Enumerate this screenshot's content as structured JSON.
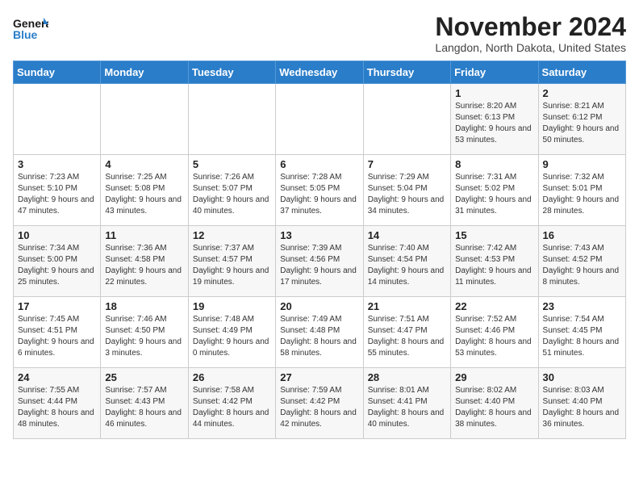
{
  "logo": {
    "line1": "General",
    "line2": "Blue"
  },
  "title": "November 2024",
  "location": "Langdon, North Dakota, United States",
  "weekdays": [
    "Sunday",
    "Monday",
    "Tuesday",
    "Wednesday",
    "Thursday",
    "Friday",
    "Saturday"
  ],
  "weeks": [
    [
      {
        "day": "",
        "info": ""
      },
      {
        "day": "",
        "info": ""
      },
      {
        "day": "",
        "info": ""
      },
      {
        "day": "",
        "info": ""
      },
      {
        "day": "",
        "info": ""
      },
      {
        "day": "1",
        "info": "Sunrise: 8:20 AM\nSunset: 6:13 PM\nDaylight: 9 hours and 53 minutes."
      },
      {
        "day": "2",
        "info": "Sunrise: 8:21 AM\nSunset: 6:12 PM\nDaylight: 9 hours and 50 minutes."
      }
    ],
    [
      {
        "day": "3",
        "info": "Sunrise: 7:23 AM\nSunset: 5:10 PM\nDaylight: 9 hours and 47 minutes."
      },
      {
        "day": "4",
        "info": "Sunrise: 7:25 AM\nSunset: 5:08 PM\nDaylight: 9 hours and 43 minutes."
      },
      {
        "day": "5",
        "info": "Sunrise: 7:26 AM\nSunset: 5:07 PM\nDaylight: 9 hours and 40 minutes."
      },
      {
        "day": "6",
        "info": "Sunrise: 7:28 AM\nSunset: 5:05 PM\nDaylight: 9 hours and 37 minutes."
      },
      {
        "day": "7",
        "info": "Sunrise: 7:29 AM\nSunset: 5:04 PM\nDaylight: 9 hours and 34 minutes."
      },
      {
        "day": "8",
        "info": "Sunrise: 7:31 AM\nSunset: 5:02 PM\nDaylight: 9 hours and 31 minutes."
      },
      {
        "day": "9",
        "info": "Sunrise: 7:32 AM\nSunset: 5:01 PM\nDaylight: 9 hours and 28 minutes."
      }
    ],
    [
      {
        "day": "10",
        "info": "Sunrise: 7:34 AM\nSunset: 5:00 PM\nDaylight: 9 hours and 25 minutes."
      },
      {
        "day": "11",
        "info": "Sunrise: 7:36 AM\nSunset: 4:58 PM\nDaylight: 9 hours and 22 minutes."
      },
      {
        "day": "12",
        "info": "Sunrise: 7:37 AM\nSunset: 4:57 PM\nDaylight: 9 hours and 19 minutes."
      },
      {
        "day": "13",
        "info": "Sunrise: 7:39 AM\nSunset: 4:56 PM\nDaylight: 9 hours and 17 minutes."
      },
      {
        "day": "14",
        "info": "Sunrise: 7:40 AM\nSunset: 4:54 PM\nDaylight: 9 hours and 14 minutes."
      },
      {
        "day": "15",
        "info": "Sunrise: 7:42 AM\nSunset: 4:53 PM\nDaylight: 9 hours and 11 minutes."
      },
      {
        "day": "16",
        "info": "Sunrise: 7:43 AM\nSunset: 4:52 PM\nDaylight: 9 hours and 8 minutes."
      }
    ],
    [
      {
        "day": "17",
        "info": "Sunrise: 7:45 AM\nSunset: 4:51 PM\nDaylight: 9 hours and 6 minutes."
      },
      {
        "day": "18",
        "info": "Sunrise: 7:46 AM\nSunset: 4:50 PM\nDaylight: 9 hours and 3 minutes."
      },
      {
        "day": "19",
        "info": "Sunrise: 7:48 AM\nSunset: 4:49 PM\nDaylight: 9 hours and 0 minutes."
      },
      {
        "day": "20",
        "info": "Sunrise: 7:49 AM\nSunset: 4:48 PM\nDaylight: 8 hours and 58 minutes."
      },
      {
        "day": "21",
        "info": "Sunrise: 7:51 AM\nSunset: 4:47 PM\nDaylight: 8 hours and 55 minutes."
      },
      {
        "day": "22",
        "info": "Sunrise: 7:52 AM\nSunset: 4:46 PM\nDaylight: 8 hours and 53 minutes."
      },
      {
        "day": "23",
        "info": "Sunrise: 7:54 AM\nSunset: 4:45 PM\nDaylight: 8 hours and 51 minutes."
      }
    ],
    [
      {
        "day": "24",
        "info": "Sunrise: 7:55 AM\nSunset: 4:44 PM\nDaylight: 8 hours and 48 minutes."
      },
      {
        "day": "25",
        "info": "Sunrise: 7:57 AM\nSunset: 4:43 PM\nDaylight: 8 hours and 46 minutes."
      },
      {
        "day": "26",
        "info": "Sunrise: 7:58 AM\nSunset: 4:42 PM\nDaylight: 8 hours and 44 minutes."
      },
      {
        "day": "27",
        "info": "Sunrise: 7:59 AM\nSunset: 4:42 PM\nDaylight: 8 hours and 42 minutes."
      },
      {
        "day": "28",
        "info": "Sunrise: 8:01 AM\nSunset: 4:41 PM\nDaylight: 8 hours and 40 minutes."
      },
      {
        "day": "29",
        "info": "Sunrise: 8:02 AM\nSunset: 4:40 PM\nDaylight: 8 hours and 38 minutes."
      },
      {
        "day": "30",
        "info": "Sunrise: 8:03 AM\nSunset: 4:40 PM\nDaylight: 8 hours and 36 minutes."
      }
    ]
  ]
}
